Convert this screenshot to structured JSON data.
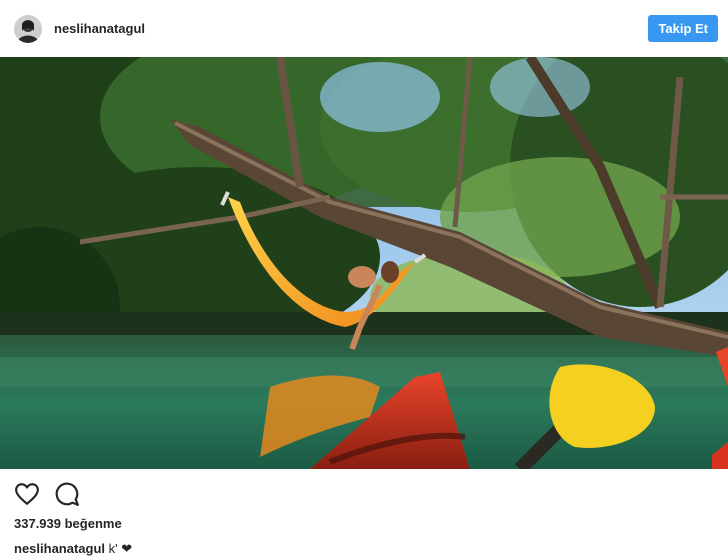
{
  "post": {
    "username": "neslihanatagul",
    "follow_label": "Takip Et",
    "likes_text": "337.939 beğenme",
    "caption_user": "neslihanatagul",
    "caption_text": "k' ❤"
  },
  "icons": {
    "like": "heart-outline-icon",
    "comment": "speech-bubble-icon"
  },
  "colors": {
    "follow_button": "#3897f0",
    "text": "#262626",
    "hammock": "#f39a1c",
    "kayak": "#d8321c",
    "paddle": "#f5d020",
    "water": "#1f6a4e"
  }
}
